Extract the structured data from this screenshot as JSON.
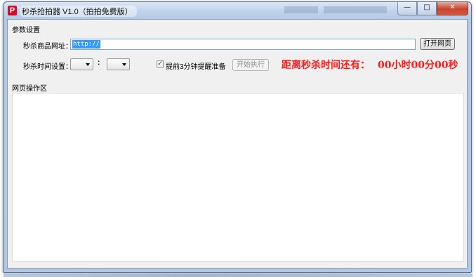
{
  "window": {
    "title": "秒杀抢拍器 V1.0（拍拍免费版）",
    "app_icon": "P",
    "controls": {
      "minimize": "—",
      "maximize": "□",
      "close": "✕"
    }
  },
  "params": {
    "group_label": "参数设置",
    "url_label": "秒杀商品网址：",
    "url_value": "http://",
    "open_button": "打开网页",
    "time_label": "秒杀时间设置：",
    "time_separator": ":",
    "hour_value": "",
    "minute_value": "",
    "remind_label": "提前3分钟提醒准备",
    "remind_checked": true,
    "start_button": "开始执行",
    "countdown_label": "距离秒杀时间还有：",
    "countdown_value": "00小时00分00秒"
  },
  "browser": {
    "group_label": "网页操作区"
  },
  "colors": {
    "countdown": "#ff1a1a",
    "title_accent": "#d0102b",
    "close_button": "#c7432d"
  }
}
